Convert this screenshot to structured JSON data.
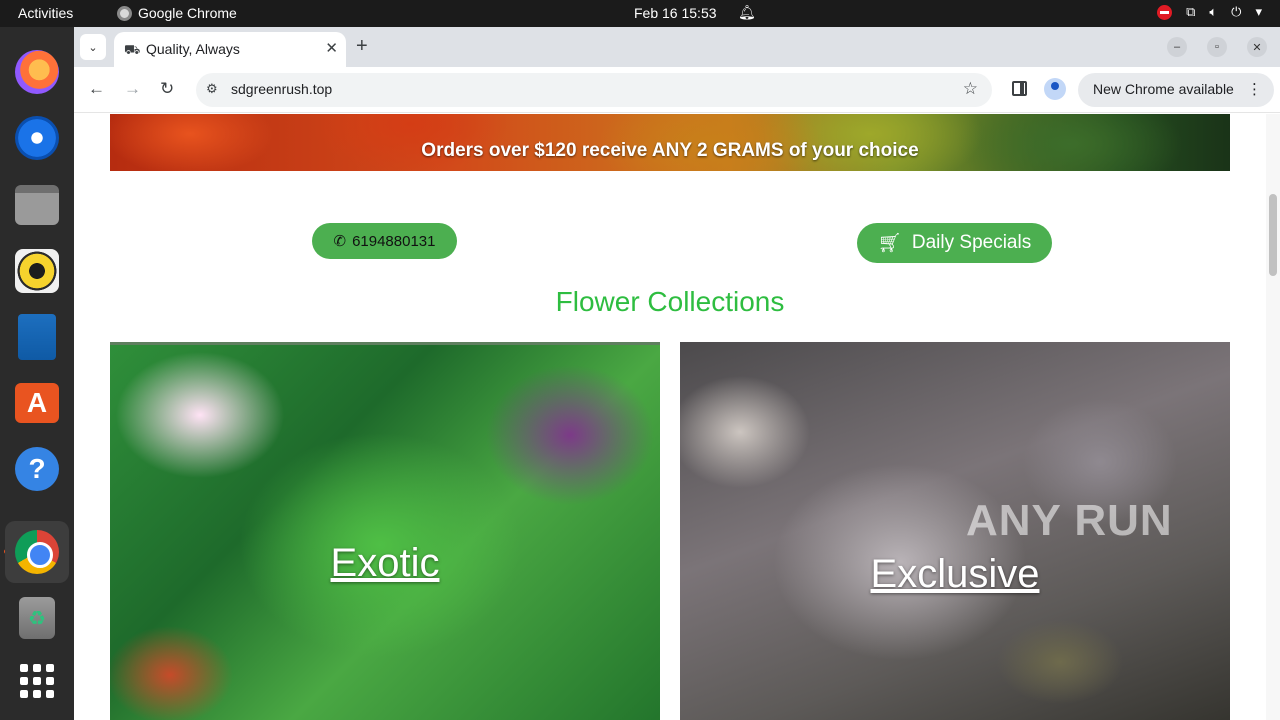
{
  "topbar": {
    "activities": "Activities",
    "app_name": "Google Chrome",
    "clock": "Feb 16  15:53"
  },
  "dock": {
    "items": [
      "firefox",
      "thunderbird",
      "files",
      "rhythmbox",
      "libreoffice-writer",
      "app-center",
      "help",
      "google-chrome",
      "trash",
      "show-apps"
    ]
  },
  "browser": {
    "tab_title": "Quality, Always",
    "url": "sdgreenrush.top",
    "update_label": "New Chrome available"
  },
  "page": {
    "banner_text": "Orders over $120 receive ANY 2 GRAMS of your choice",
    "phone_label": "6194880131",
    "specials_label": "Daily Specials",
    "section_title": "Flower Collections",
    "collections": [
      {
        "label": "Exotic"
      },
      {
        "label": "Exclusive"
      }
    ],
    "watermark": "ANY RUN"
  },
  "colors": {
    "accent_green": "#4caf50",
    "title_green": "#2ebd40",
    "topbar_bg": "#1b1b1b",
    "dock_bg": "#2b2b2b",
    "tabstrip_bg": "#dee1e6"
  }
}
